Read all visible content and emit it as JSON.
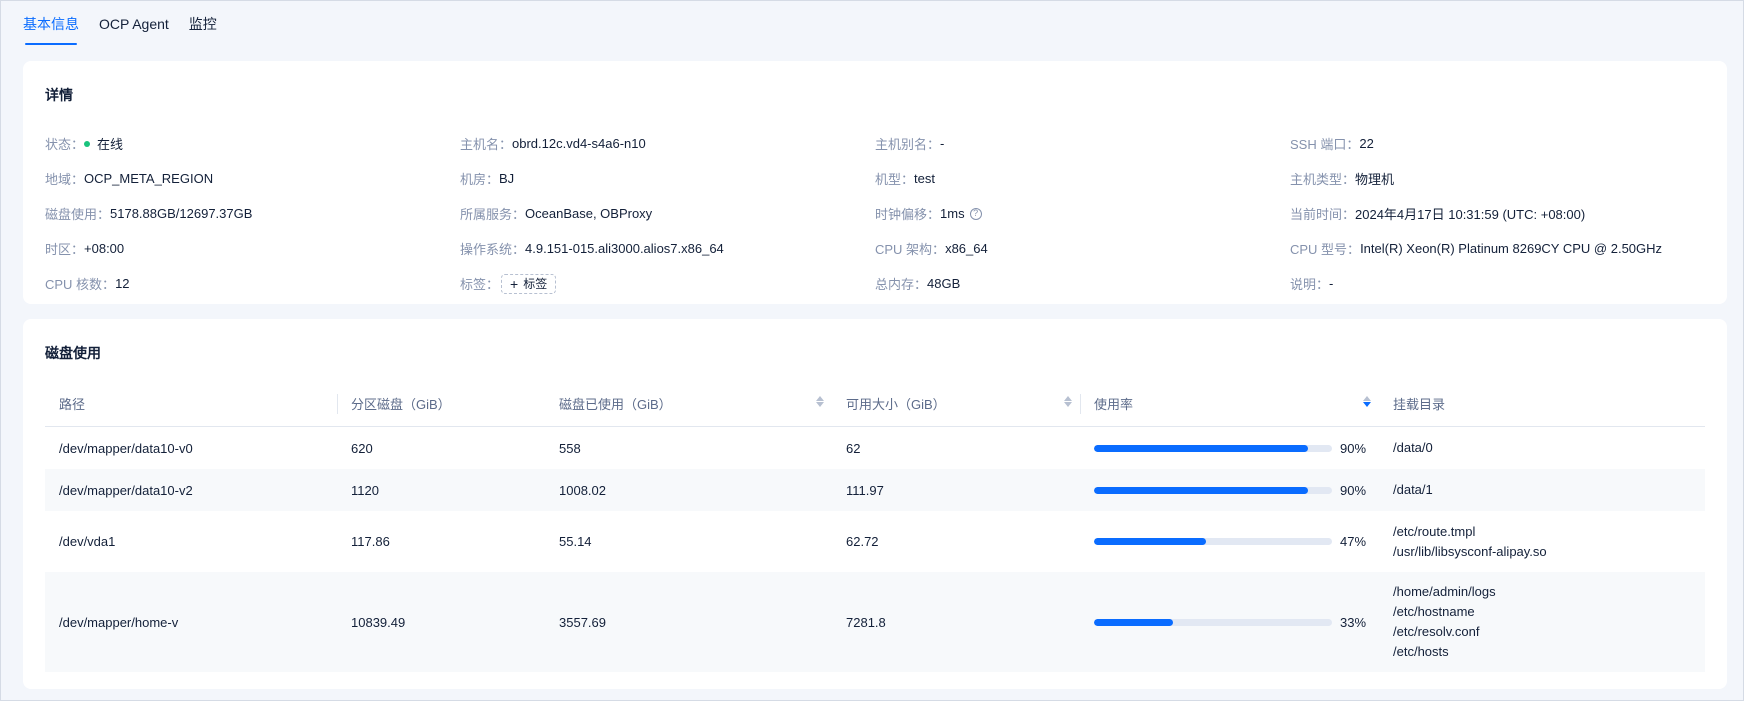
{
  "tabs": [
    {
      "label": "基本信息",
      "active": true
    },
    {
      "label": "OCP Agent",
      "active": false
    },
    {
      "label": "监控",
      "active": false
    }
  ],
  "detail": {
    "title": "详情",
    "status_label": "状态：",
    "status_value": "在线",
    "hostname_label": "主机名：",
    "hostname_value": "obrd.12c.vd4-s4a6-n10",
    "alias_label": "主机别名：",
    "alias_value": "-",
    "ssh_label": "SSH 端口：",
    "ssh_value": "22",
    "region_label": "地域：",
    "region_value": "OCP_META_REGION",
    "idc_label": "机房：",
    "idc_value": "BJ",
    "model_label": "机型：",
    "model_value": "test",
    "host_type_label": "主机类型：",
    "host_type_value": "物理机",
    "disk_label": "磁盘使用：",
    "disk_value": "5178.88GB/12697.37GB",
    "service_label": "所属服务：",
    "service_value": "OceanBase, OBProxy",
    "clock_label": "时钟偏移：",
    "clock_value": "1ms",
    "time_label": "当前时间：",
    "time_value": "2024年4月17日 10:31:59 (UTC: +08:00)",
    "tz_label": "时区：",
    "tz_value": "+08:00",
    "os_label": "操作系统：",
    "os_value": "4.9.151-015.ali3000.alios7.x86_64",
    "arch_label": "CPU 架构：",
    "arch_value": "x86_64",
    "cpu_model_label": "CPU 型号：",
    "cpu_model_value": "Intel(R) Xeon(R) Platinum 8269CY CPU @ 2.50GHz",
    "cores_label": "CPU 核数：",
    "cores_value": "12",
    "tags_label": "标签：",
    "tag_add_label": "标签",
    "memory_label": "总内存：",
    "memory_value": "48GB",
    "desc_label": "说明：",
    "desc_value": "-"
  },
  "disk": {
    "title": "磁盘使用",
    "columns": [
      "路径",
      "分区磁盘（GiB）",
      "磁盘已使用（GiB）",
      "可用大小（GiB）",
      "使用率",
      "挂载目录"
    ],
    "rows": [
      {
        "path": "/dev/mapper/data10-v0",
        "total": "620",
        "used": "558",
        "avail": "62",
        "usage": 90,
        "usage_text": "90%",
        "mounts": [
          "/data/0"
        ]
      },
      {
        "path": "/dev/mapper/data10-v2",
        "total": "1120",
        "used": "1008.02",
        "avail": "111.97",
        "usage": 90,
        "usage_text": "90%",
        "mounts": [
          "/data/1"
        ]
      },
      {
        "path": "/dev/vda1",
        "total": "117.86",
        "used": "55.14",
        "avail": "62.72",
        "usage": 47,
        "usage_text": "47%",
        "mounts": [
          "/etc/route.tmpl",
          "/usr/lib/libsysconf-alipay.so"
        ]
      },
      {
        "path": "/dev/mapper/home-v",
        "total": "10839.49",
        "used": "3557.69",
        "avail": "7281.8",
        "usage": 33,
        "usage_text": "33%",
        "mounts": [
          "/home/admin/logs",
          "/etc/hostname",
          "/etc/resolv.conf",
          "/etc/hosts"
        ]
      }
    ]
  },
  "colors": {
    "accent": "#0a6cff",
    "status_online": "#19c37d"
  }
}
